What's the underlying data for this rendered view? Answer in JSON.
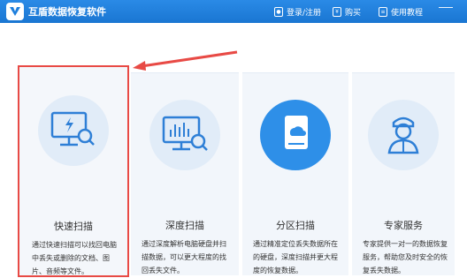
{
  "app": {
    "title": "互盾数据恢复软件"
  },
  "header": {
    "login": "登录/注册",
    "buy": "购买",
    "tutorial": "使用教程"
  },
  "cards": [
    {
      "name": "快速扫描",
      "desc": "通过快速扫描可以找回电脑中丢失或删除的文档、图片、音频等文件。"
    },
    {
      "name": "深度扫描",
      "desc": "通过深度解析电脑硬盘并扫描数据，可以更大程度的找回丢失文件。"
    },
    {
      "name": "分区扫描",
      "desc": "通过精准定位丢失数据所在的硬盘，深度扫描并更大程度的恢复数据。"
    },
    {
      "name": "专家服务",
      "desc": "专家提供一对一的数据恢复服务，帮助您及时安全的恢复丢失数据。"
    }
  ],
  "colors": {
    "accent": "#1e7fdd",
    "highlight": "#e84a45",
    "card_bg": "#f2f6fb",
    "icon_circle": "#e1ecf8"
  }
}
